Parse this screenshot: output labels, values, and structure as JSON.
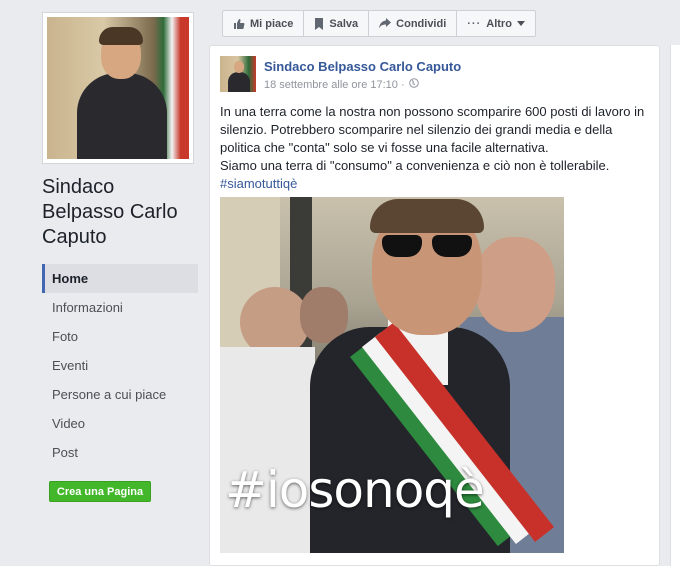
{
  "page": {
    "name_line1": "Sindaco",
    "name_line2": "Belpasso Carlo",
    "name_line3": "Caputo"
  },
  "sidebar": {
    "items": [
      {
        "label": "Home",
        "active": true
      },
      {
        "label": "Informazioni"
      },
      {
        "label": "Foto"
      },
      {
        "label": "Eventi"
      },
      {
        "label": "Persone a cui piace"
      },
      {
        "label": "Video"
      },
      {
        "label": "Post"
      }
    ],
    "create_page_label": "Crea una Pagina"
  },
  "actions": {
    "like_label": "Mi piace",
    "save_label": "Salva",
    "share_label": "Condividi",
    "more_label": "Altro"
  },
  "post": {
    "author": "Sindaco Belpasso Carlo Caputo",
    "timestamp": "18 settembre alle ore 17:10 ·",
    "text_line1": "In una terra come la nostra non possono scomparire 600 posti di lavoro in silenzio. Potrebbero scomparire nel silenzio dei grandi media e della politica che \"conta\" solo se vi fosse una facile alternativa.",
    "text_line2": "Siamo una terra di \"consumo\" a convenienza e ciò non è tollerabile.",
    "hashtag": "#siamotuttiqè",
    "image_text": "#iosonoqè"
  },
  "colors": {
    "link": "#365899",
    "create_button": "#42b72a",
    "active_nav_border": "#4267b2"
  }
}
